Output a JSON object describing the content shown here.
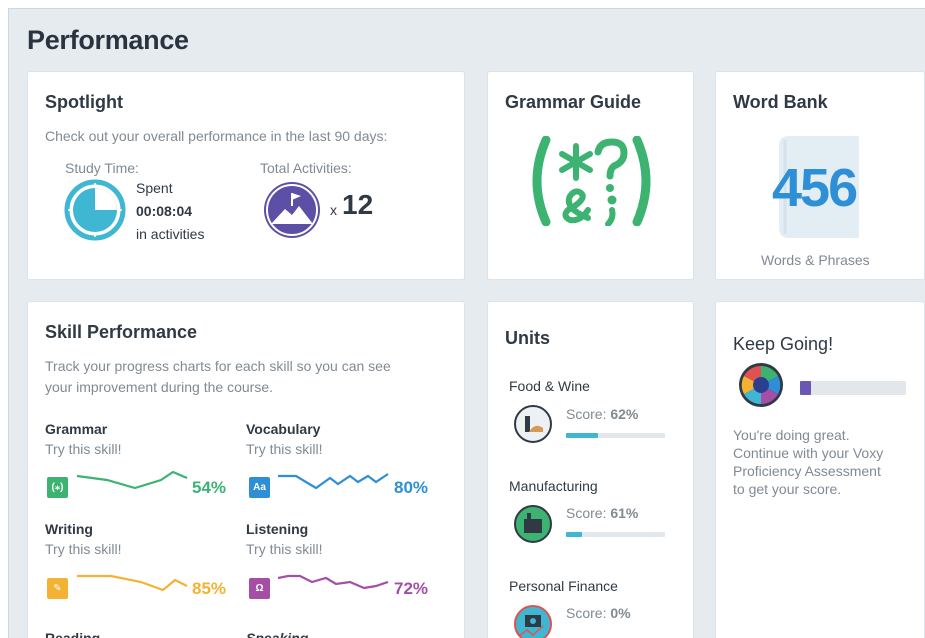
{
  "page": {
    "title": "Performance"
  },
  "spotlight": {
    "title": "Spotlight",
    "description": "Check out your overall performance in the last 90 days:",
    "study_time_label": "Study Time:",
    "spent_label": "Spent",
    "spent_value": "00:08:04",
    "spent_suffix": "in activities",
    "total_activities_label": "Total Activities:",
    "activities_prefix": "x",
    "activities_count": "12"
  },
  "grammar_guide": {
    "title": "Grammar Guide",
    "logo_text": "(*?&;)"
  },
  "word_bank": {
    "title": "Word Bank",
    "count": "456",
    "caption": "Words & Phrases"
  },
  "skills": {
    "title": "Skill Performance",
    "description_line1": "Track your progress charts for each skill so you can see",
    "description_line2": "your improvement during the course.",
    "items": [
      {
        "name": "Grammar",
        "cta": "Try this skill!",
        "percent": "54%",
        "value": 54,
        "color": "#3cb371",
        "icon": "grammar-icon"
      },
      {
        "name": "Vocabulary",
        "cta": "Try this skill!",
        "percent": "80%",
        "value": 80,
        "color": "#2f8fd6",
        "icon": "vocabulary-icon"
      },
      {
        "name": "Writing",
        "cta": "Try this skill!",
        "percent": "85%",
        "value": 85,
        "color": "#f3b233",
        "icon": "pencil-icon"
      },
      {
        "name": "Listening",
        "cta": "Try this skill!",
        "percent": "72%",
        "value": 72,
        "color": "#a44ea6",
        "icon": "headphones-icon"
      },
      {
        "name": "Reading",
        "cta": "",
        "percent": "",
        "color": "#2f3a45",
        "icon": ""
      },
      {
        "name": "Speaking",
        "cta": "",
        "percent": "",
        "color": "#2f3a45",
        "icon": ""
      }
    ]
  },
  "units": {
    "title": "Units",
    "score_prefix": "Score:",
    "items": [
      {
        "name": "Food & Wine",
        "score": "62%",
        "value": 62,
        "icon": "food-wine-icon"
      },
      {
        "name": "Manufacturing",
        "score": "61%",
        "value": 61,
        "icon": "manufacturing-icon"
      },
      {
        "name": "Personal Finance",
        "score": "0%",
        "value": 0,
        "icon": "money-icon"
      }
    ]
  },
  "keep_going": {
    "title": "Keep Going!",
    "progress": 0.1,
    "message_line1": "You're doing great.",
    "message_line2": "Continue with your Voxy",
    "message_line3": "Proficiency Assessment",
    "message_line4": "to get your score."
  },
  "colors": {
    "accent_blue": "#2f8fd6",
    "grammar_green": "#3cb371",
    "progress_purple": "#6a57b5",
    "unit_bar": "#3fb7d3"
  }
}
